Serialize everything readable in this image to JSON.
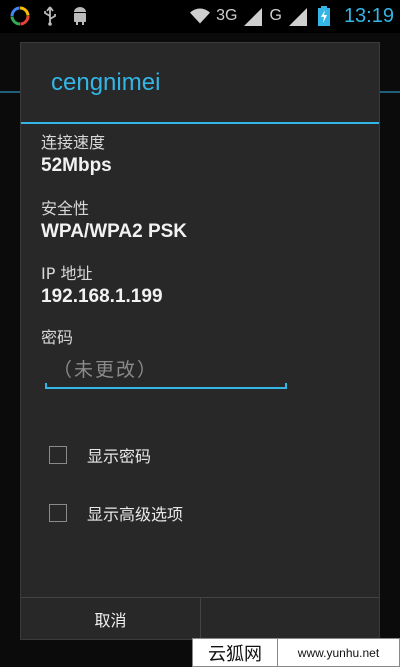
{
  "status_bar": {
    "network_3g": "3G",
    "network_g": "G",
    "time": "13:19",
    "icons": [
      "app-icon",
      "usb-icon",
      "android-debug-icon",
      "wifi-icon",
      "signal-3g-icon",
      "signal-g-icon",
      "battery-charging-icon"
    ]
  },
  "dialog": {
    "title": "cengnimei",
    "fields": [
      {
        "label": "连接速度",
        "value": "52Mbps"
      },
      {
        "label": "安全性",
        "value": "WPA/WPA2 PSK"
      },
      {
        "label": "IP 地址",
        "value": "192.168.1.199"
      }
    ],
    "password": {
      "label": "密码",
      "placeholder": "（未更改）",
      "value": ""
    },
    "checkboxes": [
      {
        "label": "显示密码",
        "checked": false
      },
      {
        "label": "显示高级选项",
        "checked": false
      }
    ],
    "buttons": {
      "cancel": "取消"
    }
  },
  "watermark": {
    "logo": "云狐网",
    "url": "www.yunhu.net"
  },
  "colors": {
    "accent": "#33b5e5",
    "dialog_bg": "#282828"
  }
}
